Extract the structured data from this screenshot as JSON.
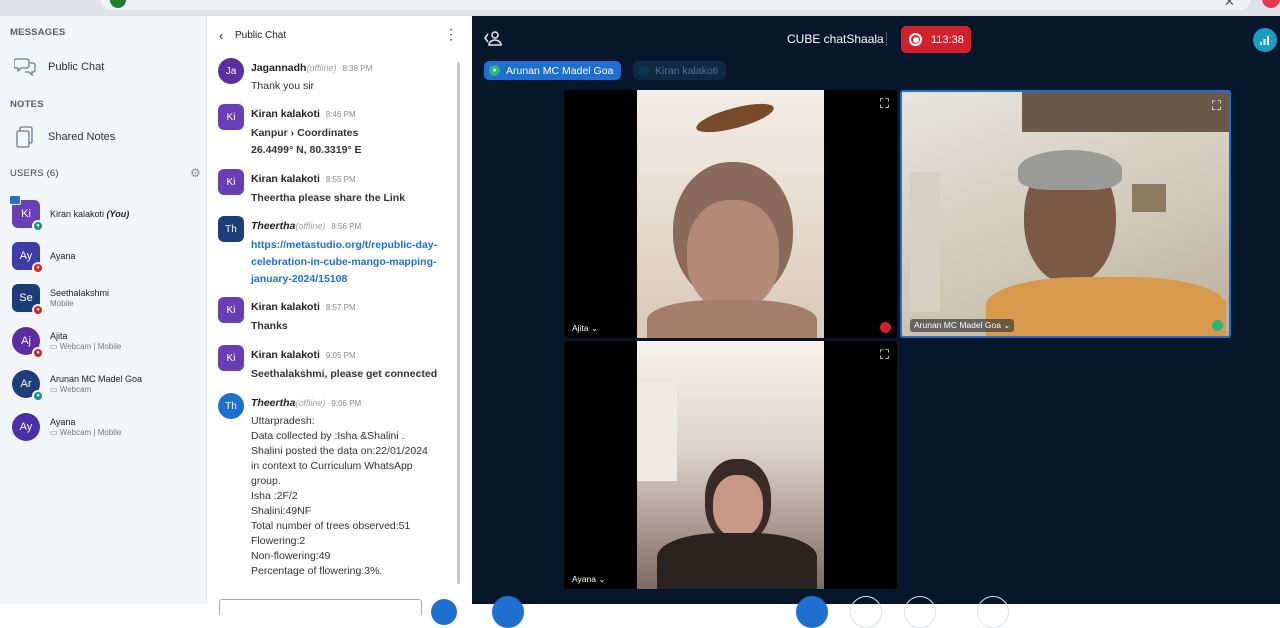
{
  "nav": {
    "messages_header": "MESSAGES",
    "public_chat": "Public Chat",
    "notes_header": "NOTES",
    "shared_notes": "Shared Notes",
    "users_header": "USERS (6)",
    "users": [
      {
        "initials": "Ki",
        "name": "Kiran kalakoti",
        "you": "(You)",
        "sub": "",
        "color": "#6a3fb5"
      },
      {
        "initials": "Ay",
        "name": "Ayana",
        "you": "",
        "sub": "",
        "color": "#3d3ca8"
      },
      {
        "initials": "Se",
        "name": "Seethalakshmi",
        "you": "",
        "sub": "Mobile",
        "color": "#1c3c7a"
      },
      {
        "initials": "Aj",
        "name": "Ajita",
        "you": "",
        "sub": "Webcam | Mobile",
        "color": "#5c2ca0"
      },
      {
        "initials": "Ar",
        "name": "Arunan MC Madel Goa",
        "you": "",
        "sub": "Webcam",
        "color": "#1d3e7a"
      },
      {
        "initials": "Ay",
        "name": "Ayana",
        "you": "",
        "sub": "Webcam | Mobile",
        "color": "#4a2fa8"
      }
    ]
  },
  "chat": {
    "title": "Public Chat",
    "messages": [
      {
        "initials": "Ja",
        "name": "Jagannadh",
        "offline": "(offline)",
        "time": "8:38 PM",
        "text": "Thank you sir"
      },
      {
        "initials": "Ki",
        "name": "Kiran kalakoti",
        "offline": "",
        "time": "8:46 PM",
        "text": "Kanpur › Coordinates\n26.4499° N, 80.3319° E"
      },
      {
        "initials": "Ki",
        "name": "Kiran kalakoti",
        "offline": "",
        "time": "8:55 PM",
        "text": "Theertha please share the Link"
      },
      {
        "initials": "Th",
        "name": "Theertha",
        "offline": "(offline)",
        "time": "8:56 PM",
        "text": "https://metastudio.org/t/republic-day-celebration-in-cube-mango-mapping-january-2024/15108"
      },
      {
        "initials": "Ki",
        "name": "Kiran kalakoti",
        "offline": "",
        "time": "8:57 PM",
        "text": "Thanks"
      },
      {
        "initials": "Ki",
        "name": "Kiran kalakoti",
        "offline": "",
        "time": "9:05 PM",
        "text": "Seethalakshmi, please get connected"
      },
      {
        "initials": "Th",
        "name": "Theertha",
        "offline": "(offline)",
        "time": "9:06 PM",
        "text": "Uttarpradesh:\nData collected by :Isha &Shalini .\nShalini posted the data on:22/01/2024\nin context to Curriculum WhatsApp\ngroup.\nIsha :2F/2\nShalini:49NF\nTotal number of trees observed:51\nFlowering:2\nNon-flowering:49\nPercentage of flowering:3%."
      }
    ]
  },
  "meeting": {
    "title": "CUBE chatShaala",
    "recording_time": "113:38",
    "talking": [
      "Arunan MC Madel Goa",
      "Kiran kalakoti"
    ],
    "videos": [
      {
        "name": "Ajita"
      },
      {
        "name": "Arunan MC Madel Goa"
      },
      {
        "name": "Ayana"
      }
    ]
  }
}
